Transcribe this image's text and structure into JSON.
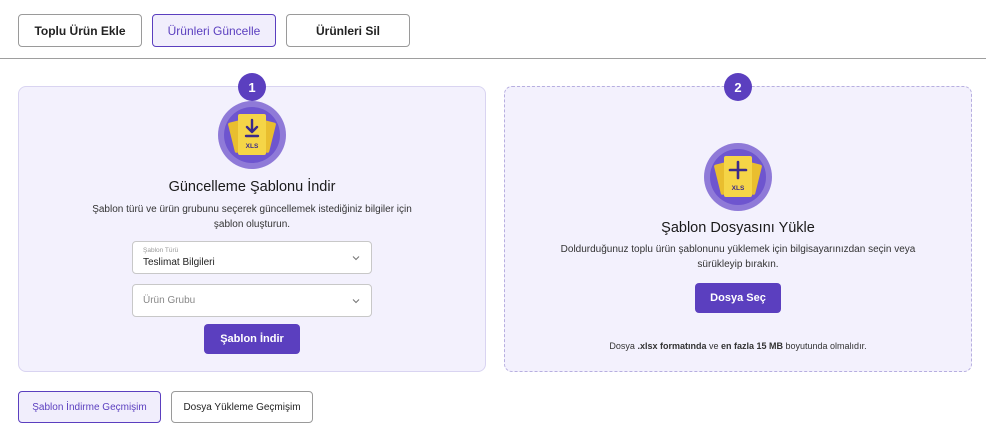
{
  "tabs": [
    {
      "label": "Toplu Ürün Ekle",
      "active": false
    },
    {
      "label": "Ürünleri Güncelle",
      "active": true
    },
    {
      "label": "Ürünleri Sil",
      "active": false
    }
  ],
  "download_card": {
    "step": "1",
    "icon": "xls-download-icon",
    "icon_label": "XLS",
    "title": "Güncelleme Şablonu İndir",
    "description": "Şablon türü ve ürün grubunu seçerek  güncellemek istediğiniz bilgiler için şablon oluşturun.",
    "template_type": {
      "label": "Şablon Türü",
      "value": "Teslimat Bilgileri"
    },
    "product_group": {
      "placeholder": "Ürün Grubu"
    },
    "button_label": "Şablon İndir"
  },
  "upload_card": {
    "step": "2",
    "icon": "xls-upload-icon",
    "icon_label": "XLS",
    "title": "Şablon Dosyasını Yükle",
    "description": "Doldurduğunuz toplu ürün şablonunu yüklemek için bilgisayarınızdan seçin veya sürükleyip bırakın.",
    "button_label": "Dosya Seç",
    "note": {
      "p1": "Dosya ",
      "b1": ".xlsx formatında",
      "p2": " ve ",
      "b2": "en fazla 15 MB",
      "p3": " boyutunda olmalıdır."
    }
  },
  "history": [
    {
      "label": "Şablon İndirme Geçmişim",
      "active": true
    },
    {
      "label": "Dosya Yükleme Geçmişim",
      "active": false
    }
  ],
  "colors": {
    "accent": "#5b3fbf",
    "card_bg": "#f3f1fd",
    "icon_yellow": "#f5d547"
  }
}
